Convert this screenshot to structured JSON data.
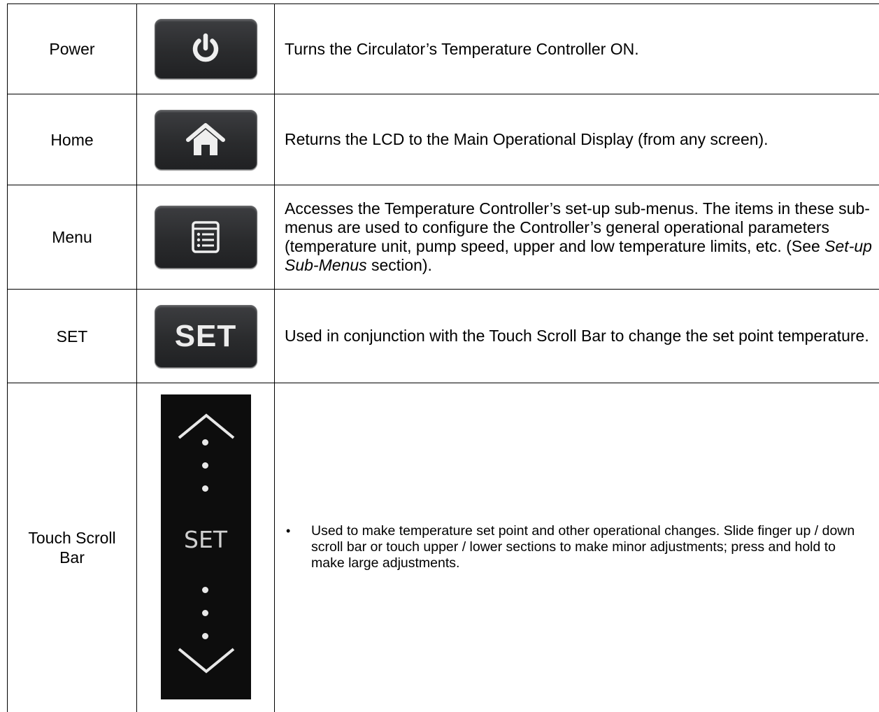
{
  "rows": [
    {
      "name": "Power",
      "icon": "power-icon",
      "description": "Turns the Circulator’s Temperature Controller ON."
    },
    {
      "name": "Home",
      "icon": "home-icon",
      "description": "Returns the LCD to the Main Operational Display (from any screen)."
    },
    {
      "name": "Menu",
      "icon": "menu-list-icon",
      "description_before": "Accesses the Temperature Controller’s set-up sub-menus. The items in these sub-menus are used to configure the Controller’s general operational parameters (temperature unit, pump speed, upper and low temperature limits, etc. (See ",
      "description_italic": "Set-up Sub-Menus",
      "description_after": " section)."
    },
    {
      "name": "SET",
      "key_label": "SET",
      "description": "Used in conjunction with the Touch Scroll Bar to change the set point temperature."
    },
    {
      "name": "Touch Scroll Bar",
      "scroll_label": "SET",
      "bullet": "•",
      "description": "Used to make temperature set point and other operational changes. Slide finger up / down scroll bar or touch upper / lower sections to make minor adjustments; press and hold to make large adjustments."
    }
  ]
}
